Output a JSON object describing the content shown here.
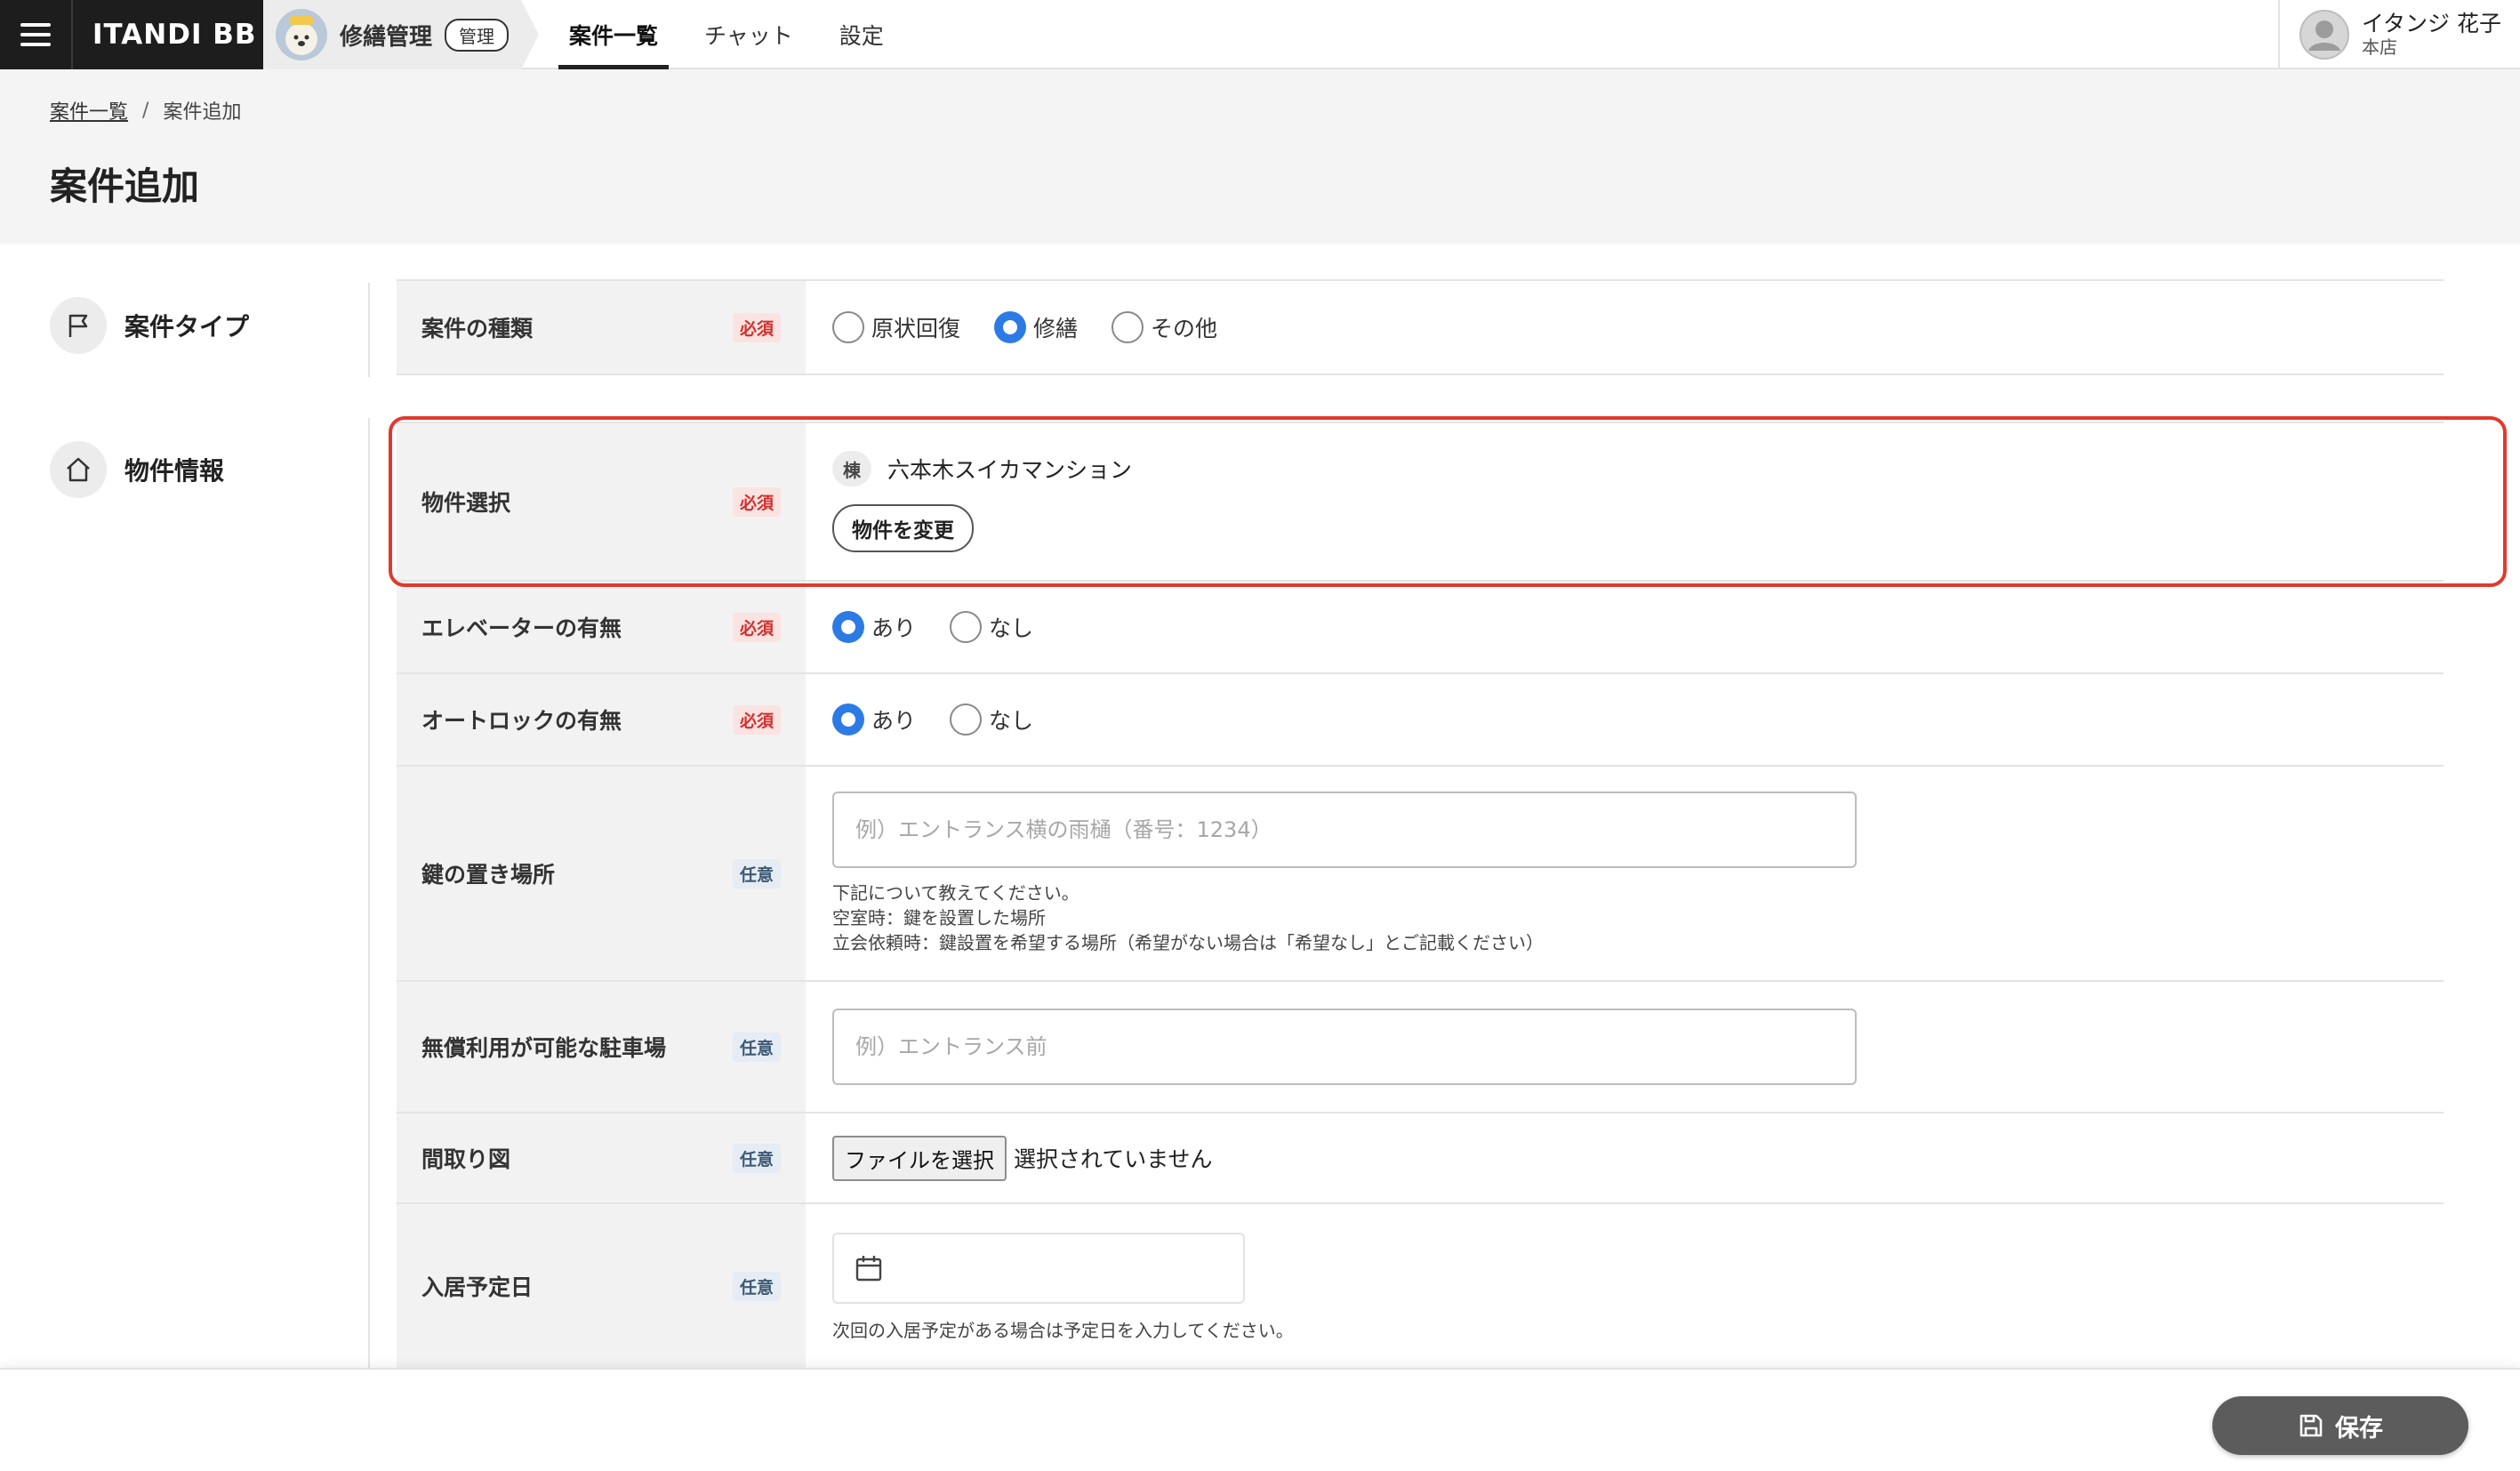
{
  "header": {
    "brand": "ITANDI BB",
    "app_name": "修繕管理",
    "app_badge": "管理",
    "nav": [
      {
        "label": "案件一覧",
        "active": true
      },
      {
        "label": "チャット",
        "active": false
      },
      {
        "label": "設定",
        "active": false
      }
    ],
    "user": {
      "name": "イタンジ 花子",
      "branch": "本店"
    }
  },
  "breadcrumb": {
    "parent": "案件一覧",
    "separator": "/",
    "current": "案件追加"
  },
  "page_title": "案件追加",
  "sections": {
    "case_type": {
      "label": "案件タイプ",
      "icon": "flag-icon"
    },
    "property_info": {
      "label": "物件情報",
      "icon": "home-icon"
    }
  },
  "form": {
    "case_kind": {
      "label": "案件の種類",
      "badge": "必須",
      "options": [
        "原状回復",
        "修繕",
        "その他"
      ],
      "selected": "修繕"
    },
    "property_select": {
      "label": "物件選択",
      "badge": "必須",
      "building_badge": "棟",
      "property_name": "六本木スイカマンション",
      "change_button": "物件を変更"
    },
    "elevator": {
      "label": "エレベーターの有無",
      "badge": "必須",
      "options": [
        "あり",
        "なし"
      ],
      "selected": "あり"
    },
    "autolock": {
      "label": "オートロックの有無",
      "badge": "必須",
      "options": [
        "あり",
        "なし"
      ],
      "selected": "あり"
    },
    "key_location": {
      "label": "鍵の置き場所",
      "badge": "任意",
      "placeholder": "例）エントランス横の雨樋（番号：1234）",
      "value": "",
      "hint_lines": [
        "下記について教えてください。",
        "空室時：鍵を設置した場所",
        "立会依頼時：鍵設置を希望する場所（希望がない場合は「希望なし」とご記載ください）"
      ]
    },
    "free_parking": {
      "label": "無償利用が可能な駐車場",
      "badge": "任意",
      "placeholder": "例）エントランス前",
      "value": ""
    },
    "floor_plan": {
      "label": "間取り図",
      "badge": "任意",
      "file_button": "ファイルを選択",
      "file_status": "選択されていません"
    },
    "move_in_date": {
      "label": "入居予定日",
      "badge": "任意",
      "value": "",
      "hint": "次回の入居予定がある場合は予定日を入力してください。"
    }
  },
  "footer": {
    "save_label": "保存"
  },
  "colors": {
    "accent_radio": "#2c7be5",
    "required_badge": "#d0312d",
    "highlight_border": "#e03a2e",
    "save_button": "#5c5c5c"
  }
}
